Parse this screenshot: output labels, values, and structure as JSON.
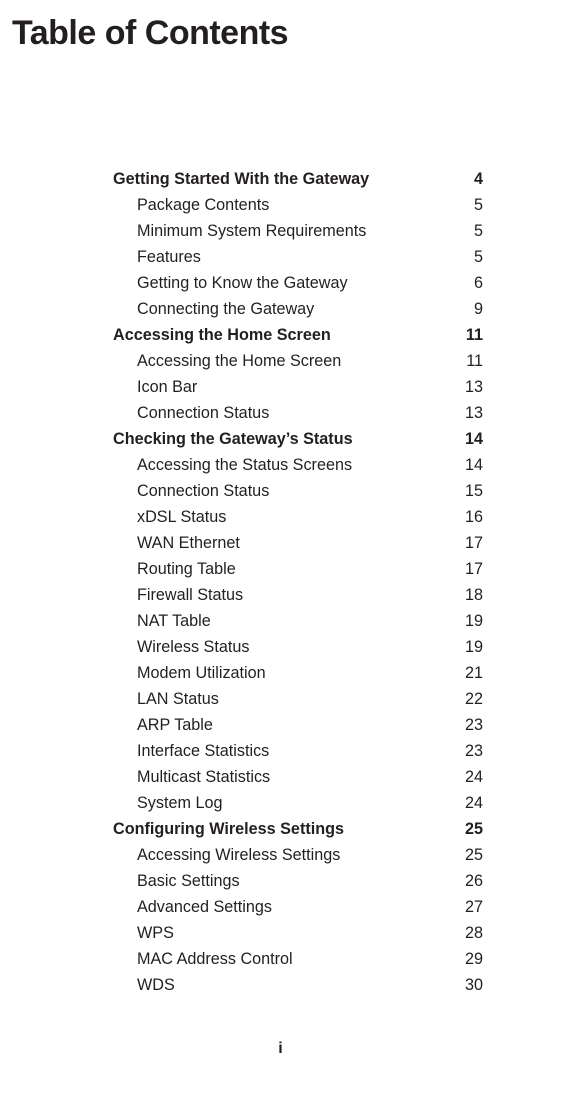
{
  "title": "Table of Contents",
  "page_number": "i",
  "toc": [
    {
      "type": "section",
      "label": "Getting Started With the Gateway",
      "page": "4"
    },
    {
      "type": "sub",
      "label": "Package Contents",
      "page": "5"
    },
    {
      "type": "sub",
      "label": "Minimum System Requirements",
      "page": "5"
    },
    {
      "type": "sub",
      "label": "Features",
      "page": "5"
    },
    {
      "type": "sub",
      "label": "Getting to Know the Gateway",
      "page": "6"
    },
    {
      "type": "sub",
      "label": "Connecting the Gateway",
      "page": "9"
    },
    {
      "type": "section",
      "label": "Accessing the Home Screen",
      "page": "11"
    },
    {
      "type": "sub",
      "label": "Accessing the Home Screen",
      "page": "11"
    },
    {
      "type": "sub",
      "label": "Icon Bar",
      "page": "13"
    },
    {
      "type": "sub",
      "label": "Connection Status",
      "page": "13"
    },
    {
      "type": "section",
      "label": "Checking the Gateway’s Status",
      "page": "14"
    },
    {
      "type": "sub",
      "label": "Accessing the Status Screens",
      "page": "14"
    },
    {
      "type": "sub",
      "label": "Connection Status",
      "page": "15"
    },
    {
      "type": "sub",
      "label": "xDSL Status",
      "page": "16"
    },
    {
      "type": "sub",
      "label": "WAN Ethernet",
      "page": "17"
    },
    {
      "type": "sub",
      "label": "Routing Table",
      "page": "17"
    },
    {
      "type": "sub",
      "label": "Firewall Status",
      "page": "18"
    },
    {
      "type": "sub",
      "label": "NAT Table",
      "page": "19"
    },
    {
      "type": "sub",
      "label": "Wireless Status",
      "page": "19"
    },
    {
      "type": "sub",
      "label": "Modem Utilization",
      "page": "21"
    },
    {
      "type": "sub",
      "label": "LAN Status",
      "page": "22"
    },
    {
      "type": "sub",
      "label": "ARP Table",
      "page": "23"
    },
    {
      "type": "sub",
      "label": "Interface Statistics",
      "page": "23"
    },
    {
      "type": "sub",
      "label": "Multicast Statistics",
      "page": "24"
    },
    {
      "type": "sub",
      "label": "System Log",
      "page": "24"
    },
    {
      "type": "section",
      "label": "Configuring Wireless Settings",
      "page": "25"
    },
    {
      "type": "sub",
      "label": "Accessing Wireless Settings",
      "page": "25"
    },
    {
      "type": "sub",
      "label": "Basic Settings",
      "page": "26"
    },
    {
      "type": "sub",
      "label": "Advanced Settings",
      "page": "27"
    },
    {
      "type": "sub",
      "label": "WPS",
      "page": "28"
    },
    {
      "type": "sub",
      "label": "MAC Address Control",
      "page": "29"
    },
    {
      "type": "sub",
      "label": "WDS",
      "page": "30"
    }
  ]
}
